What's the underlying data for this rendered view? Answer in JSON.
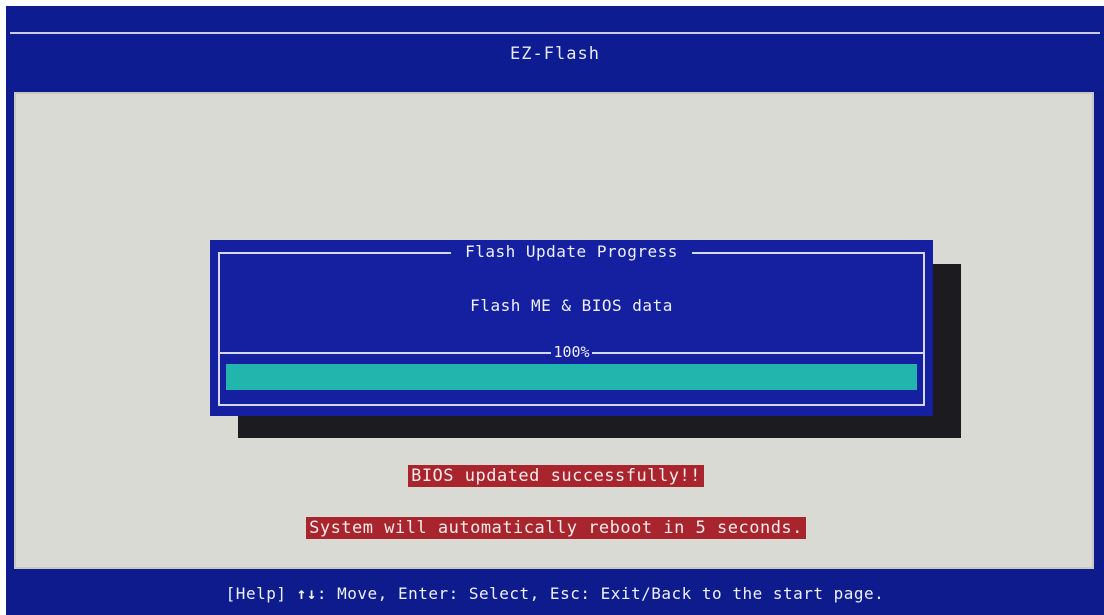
{
  "window": {
    "title": "EZ-Flash"
  },
  "dialog": {
    "title": "Flash Update Progress",
    "subtitle": "Flash ME & BIOS data",
    "progress_label": "100%",
    "progress_fraction": 1.0
  },
  "messages": {
    "success": "BIOS updated successfully!!",
    "reboot": "System will automatically reboot in 5 seconds."
  },
  "help_bar": {
    "help_prefix": "[Help]",
    "arrows": "↑↓",
    "text": ": Move, Enter: Select, Esc: Exit/Back to the start page."
  },
  "colors": {
    "background_blue": "#0d1b8c",
    "dialog_blue": "#1420a0",
    "main_area_gray": "#d9dad3",
    "progress_teal": "#21b5ad",
    "message_red": "#a8252e"
  }
}
